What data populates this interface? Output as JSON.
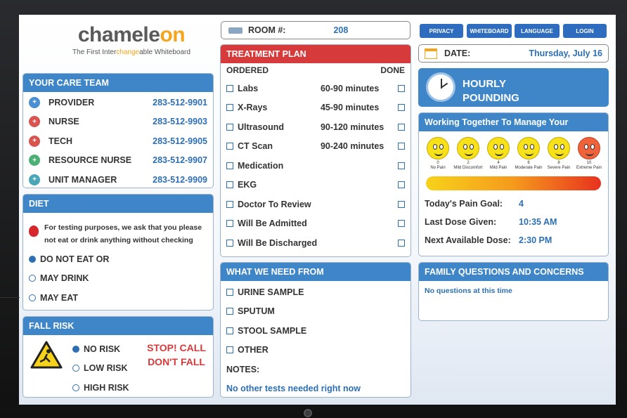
{
  "logo": {
    "name_a": "chamele",
    "name_o": "on",
    "tagline_a": "The First Inter",
    "tagline_c": "change",
    "tagline_b": "able Whiteboard"
  },
  "room": {
    "label": "ROOM #:",
    "value": "208"
  },
  "nav": {
    "privacy": "PRIVACY",
    "whiteboard": "WHITEBOARD",
    "language": "LANGUAGE",
    "login": "LOGIN"
  },
  "date": {
    "label": "DATE:",
    "value": "Thursday, July 16"
  },
  "hourly": {
    "label": "HOURLY",
    "label2": "POUNDING"
  },
  "care_team": {
    "title": "YOUR CARE TEAM",
    "members": [
      {
        "role": "PROVIDER",
        "phone": "283-512-9901",
        "color": "#4a8fd1",
        "icon": "stethoscope-icon"
      },
      {
        "role": "NURSE",
        "phone": "283-512-9903",
        "color": "#d9534f",
        "icon": "nurse-icon"
      },
      {
        "role": "TECH",
        "phone": "283-512-9905",
        "color": "#d9534f",
        "icon": "heart-icon"
      },
      {
        "role": "RESOURCE NURSE",
        "phone": "283-512-9907",
        "color": "#4caf73",
        "icon": "medical-cross-icon"
      },
      {
        "role": "UNIT MANAGER",
        "phone": "283-512-9909",
        "color": "#4aa7b8",
        "icon": "clipboard-icon"
      }
    ]
  },
  "diet": {
    "title": "DIET",
    "note": "For testing purposes, we ask that you please not eat or drink anything without checking with your nurse.",
    "options": [
      "DO NOT EAT OR",
      "MAY DRINK",
      "MAY EAT"
    ],
    "selected": 0
  },
  "fall_risk": {
    "title": "FALL RISK",
    "options": [
      "NO RISK",
      "LOW RISK",
      "HIGH RISK"
    ],
    "selected": 0,
    "warning": "STOP! CALL DON'T FALL"
  },
  "treatment": {
    "title": "TREATMENT PLAN",
    "col_ordered": "ORDERED",
    "col_done": "DONE",
    "items": [
      {
        "name": "Labs",
        "time": "60-90 minutes"
      },
      {
        "name": "X-Rays",
        "time": "45-90 minutes"
      },
      {
        "name": "Ultrasound",
        "time": "90-120 minutes"
      },
      {
        "name": "CT Scan",
        "time": "90-240 minutes"
      },
      {
        "name": "Medication",
        "time": ""
      },
      {
        "name": "EKG",
        "time": ""
      },
      {
        "name": "Doctor To Review",
        "time": ""
      },
      {
        "name": "Will Be Admitted",
        "time": ""
      },
      {
        "name": "Will Be Discharged",
        "time": ""
      }
    ]
  },
  "needs": {
    "title": "WHAT WE NEED FROM",
    "items": [
      "URINE SAMPLE",
      "SPUTUM",
      "STOOL SAMPLE",
      "OTHER"
    ],
    "notes_label": "NOTES:",
    "notes_value": "No other tests needed right now"
  },
  "pain": {
    "title": "Working Together To Manage Your",
    "scale": [
      {
        "n": "0",
        "label": "No Pain"
      },
      {
        "n": "2",
        "label": "Mild Discomfort"
      },
      {
        "n": "4",
        "label": "Mild Pain"
      },
      {
        "n": "6",
        "label": "Moderate Pain"
      },
      {
        "n": "8",
        "label": "Severe Pain"
      },
      {
        "n": "10",
        "label": "Extreme Pain"
      }
    ],
    "goal_label": "Today's Pain Goal:",
    "goal_value": "4",
    "last_label": "Last Dose Given:",
    "last_value": "10:35 AM",
    "next_label": "Next Available Dose:",
    "next_value": "2:30 PM"
  },
  "family": {
    "title": "FAMILY QUESTIONS AND CONCERNS",
    "text": "No questions at this time"
  }
}
